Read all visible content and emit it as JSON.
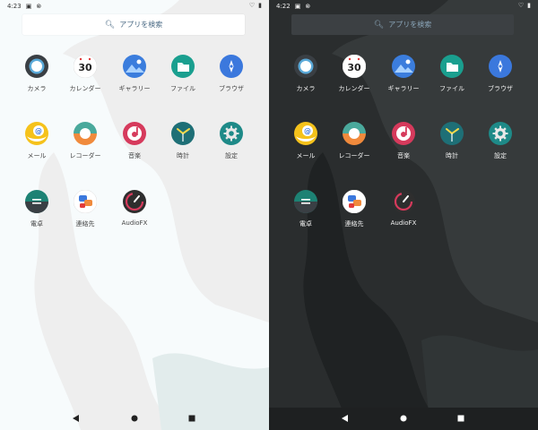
{
  "screens": [
    {
      "id": "light",
      "theme": "light",
      "status": {
        "time": "4:23",
        "left_icons": [
          "notification-icon",
          "sync-icon"
        ],
        "right_icons": [
          "wifi-icon",
          "battery-icon"
        ]
      },
      "search": {
        "label": "アプリを検索",
        "icon": "search-icon"
      }
    },
    {
      "id": "dark",
      "theme": "dark",
      "status": {
        "time": "4:22",
        "left_icons": [
          "notification-icon",
          "sync-icon"
        ],
        "right_icons": [
          "wifi-icon",
          "battery-icon"
        ]
      },
      "search": {
        "label": "アプリを検索",
        "icon": "search-icon"
      }
    }
  ],
  "apps": [
    {
      "key": "camera",
      "label": "カメラ",
      "icon": "camera-icon"
    },
    {
      "key": "calendar",
      "label": "カレンダー",
      "icon": "calendar-icon",
      "icon_text": "30"
    },
    {
      "key": "gallery",
      "label": "ギャラリー",
      "icon": "gallery-icon"
    },
    {
      "key": "files",
      "label": "ファイル",
      "icon": "files-icon"
    },
    {
      "key": "browser",
      "label": "ブラウザ",
      "icon": "browser-icon"
    },
    {
      "key": "mail",
      "label": "メール",
      "icon": "mail-icon",
      "icon_text": "@"
    },
    {
      "key": "recorder",
      "label": "レコーダー",
      "icon": "recorder-icon"
    },
    {
      "key": "music",
      "label": "音楽",
      "icon": "music-icon"
    },
    {
      "key": "clock",
      "label": "時計",
      "icon": "clock-icon"
    },
    {
      "key": "settings",
      "label": "設定",
      "icon": "settings-icon"
    },
    {
      "key": "calculator",
      "label": "電卓",
      "icon": "calculator-icon"
    },
    {
      "key": "contacts",
      "label": "連絡先",
      "icon": "contacts-icon"
    },
    {
      "key": "audiofx",
      "label": "AudioFX",
      "icon": "audiofx-icon"
    }
  ],
  "nav": {
    "icons": [
      "back-icon",
      "home-icon",
      "recent-apps-icon"
    ]
  },
  "colors": {
    "light_bg": "#f7fbfc",
    "dark_bg": "#2a2d2e",
    "accent_blue": "#3b7ddd",
    "accent_teal": "#1a9f8f"
  }
}
